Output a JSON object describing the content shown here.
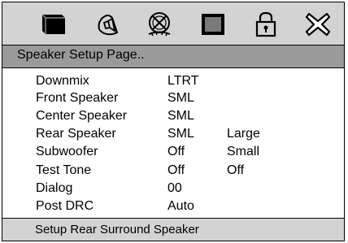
{
  "icons": [
    {
      "name": "general-setup-icon"
    },
    {
      "name": "speaker-setup-icon"
    },
    {
      "name": "audio-setup-icon"
    },
    {
      "name": "video-setup-icon"
    },
    {
      "name": "lock-icon"
    },
    {
      "name": "exit-icon"
    }
  ],
  "header": {
    "title": "Speaker Setup Page.."
  },
  "settings": [
    {
      "label": "Downmix",
      "value": "LTRT",
      "option": ""
    },
    {
      "label": "Front Speaker",
      "value": "SML",
      "option": ""
    },
    {
      "label": "Center Speaker",
      "value": "SML",
      "option": ""
    },
    {
      "label": "Rear Speaker",
      "value": "SML",
      "option": "Large"
    },
    {
      "label": "Subwoofer",
      "value": "Off",
      "option": "Small"
    },
    {
      "label": "Test Tone",
      "value": "Off",
      "option": "Off"
    },
    {
      "label": "Dialog",
      "value": "00",
      "option": ""
    },
    {
      "label": "Post DRC",
      "value": "Auto",
      "option": ""
    }
  ],
  "footer": {
    "hint": "Setup Rear Surround Speaker"
  }
}
